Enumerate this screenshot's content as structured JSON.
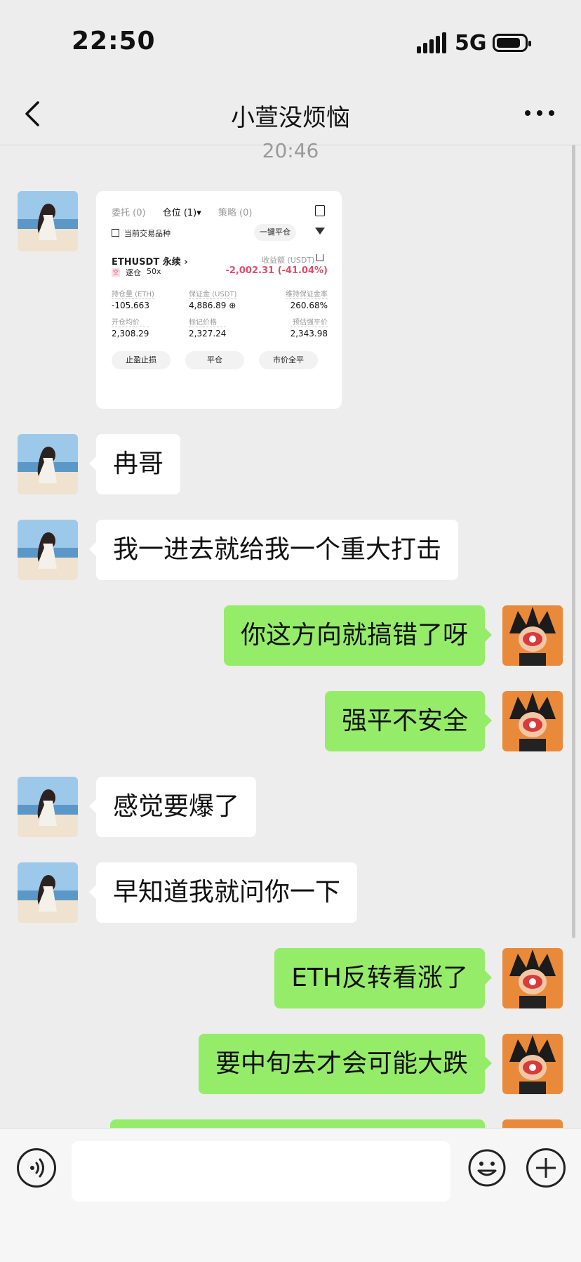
{
  "status_bar": {
    "time": "22:50",
    "network": "5G"
  },
  "nav": {
    "title": "小萱没烦恼"
  },
  "timestamp": "20:46",
  "trade_card": {
    "tabs": [
      "委托 (0)",
      "仓位 (1)▾",
      "策略 (0)"
    ],
    "checkbox_label": "当前交易品种",
    "close_all_button": "一键平仓",
    "symbol": "ETHUSDT 永续 ›",
    "pnl_label": "收益额 (USDT)",
    "mode": "逐仓",
    "leverage": "50x",
    "pnl_value": "-2,002.31 (-41.04%)",
    "fields": [
      {
        "label": "持仓量 (ETH)",
        "value": "-105.663"
      },
      {
        "label": "保证金 (USDT)",
        "value": "4,886.89 ⊕"
      },
      {
        "label": "维持保证金率",
        "value": "260.68%"
      },
      {
        "label": "开仓均价",
        "value": "2,308.29"
      },
      {
        "label": "标记价格",
        "value": "2,327.24"
      },
      {
        "label": "预估强平价",
        "value": "2,343.98"
      }
    ],
    "buttons": [
      "止盈止损",
      "平仓",
      "市价全平"
    ]
  },
  "messages": [
    {
      "side": "left",
      "text": "冉哥"
    },
    {
      "side": "left",
      "text": "我一进去就给我一个重大打击"
    },
    {
      "side": "right",
      "text": "你这方向就搞错了呀"
    },
    {
      "side": "right",
      "text": "强平不安全"
    },
    {
      "side": "left",
      "text": "感觉要爆了"
    },
    {
      "side": "left",
      "text": "早知道我就问你一下"
    },
    {
      "side": "right",
      "text": "ETH反转看涨了"
    },
    {
      "side": "right",
      "text": "要中旬去才会可能大跌"
    }
  ],
  "colors": {
    "background": "#ededed",
    "sent_bubble": "#95ec69",
    "received_bubble": "#ffffff",
    "loss_red": "#e04d68"
  },
  "icons": [
    "back-icon",
    "more-icon",
    "voice-icon",
    "emoji-icon",
    "plus-icon"
  ]
}
